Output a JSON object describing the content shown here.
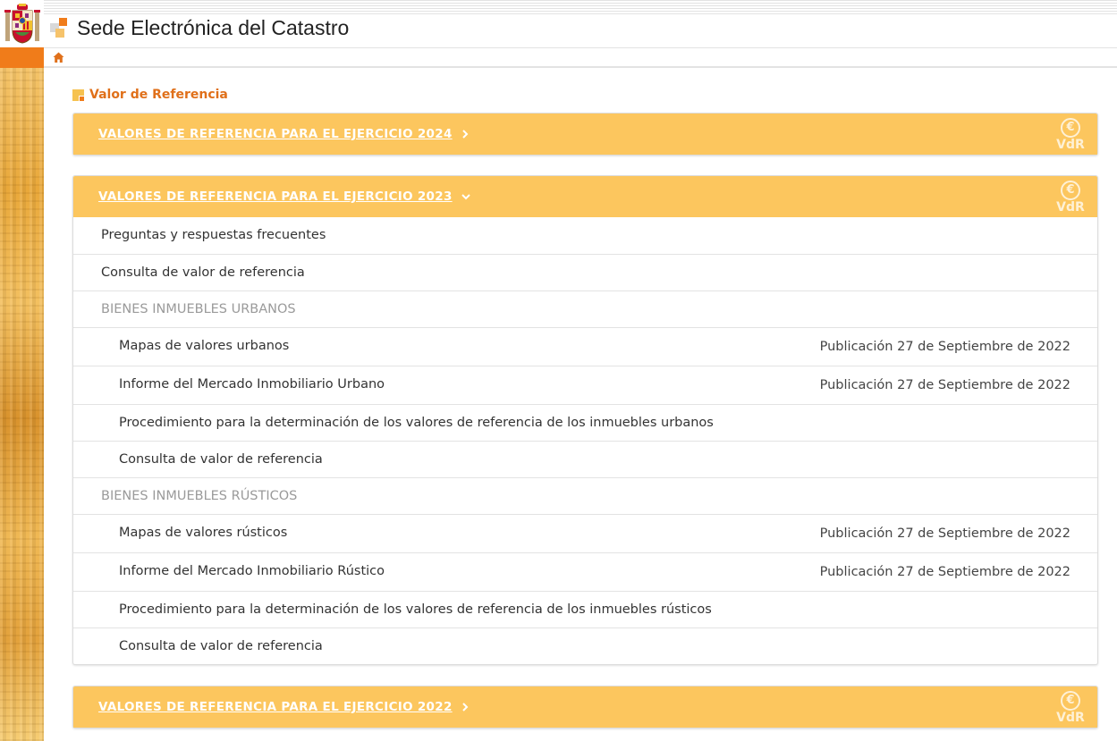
{
  "header": {
    "site_title": "Sede Electrónica del Catastro"
  },
  "page": {
    "heading": "Valor de Referencia"
  },
  "panels": [
    {
      "title": "VALORES DE REFERENCIA PARA EL EJERCICIO 2024",
      "expanded": false,
      "badge": "VdR"
    },
    {
      "title": "VALORES DE REFERENCIA PARA EL EJERCICIO 2023",
      "expanded": true,
      "badge": "VdR",
      "items": [
        {
          "label": "Preguntas y respuestas frecuentes",
          "type": "link"
        },
        {
          "label": "Consulta de valor de referencia",
          "type": "link"
        },
        {
          "label": "BIENES INMUEBLES URBANOS",
          "type": "section"
        },
        {
          "label": "Mapas de valores urbanos",
          "type": "link",
          "pub": "Publicación 27 de Septiembre de 2022"
        },
        {
          "label": "Informe del Mercado Inmobiliario Urbano",
          "type": "link",
          "pub": "Publicación 27 de Septiembre de 2022"
        },
        {
          "label": "Procedimiento para la determinación de los valores de referencia de los inmuebles urbanos",
          "type": "link"
        },
        {
          "label": "Consulta de valor de referencia",
          "type": "link"
        },
        {
          "label": "BIENES INMUEBLES RÚSTICOS",
          "type": "section"
        },
        {
          "label": "Mapas de valores rústicos",
          "type": "link",
          "pub": "Publicación 27 de Septiembre de 2022"
        },
        {
          "label": "Informe del Mercado Inmobiliario Rústico",
          "type": "link",
          "pub": "Publicación 27 de Septiembre de 2022"
        },
        {
          "label": "Procedimiento para la determinación de los valores de referencia de los inmuebles rústicos",
          "type": "link"
        },
        {
          "label": "Consulta de valor de referencia",
          "type": "link"
        }
      ]
    },
    {
      "title": "VALORES DE REFERENCIA PARA EL EJERCICIO 2022",
      "expanded": false,
      "badge": "VdR"
    }
  ],
  "icons": {
    "home": "home-icon",
    "chevron_right": "chevron-right-icon",
    "chevron_down": "chevron-down-icon",
    "euro_badge": "euro-icon"
  },
  "colors": {
    "accent": "#f07c1a",
    "panel_header": "#fcc65e",
    "heading": "#e0701a"
  }
}
